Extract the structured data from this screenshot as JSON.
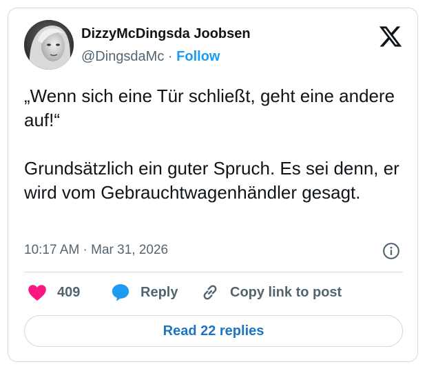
{
  "author": {
    "display_name": "DizzyMcDingsda Joobsen",
    "handle": "@DingsdaMc",
    "separator": "·",
    "follow_label": "Follow"
  },
  "tweet": {
    "text": "„Wenn sich eine Tür schließt, geht eine andere auf!“\n\nGrundsätzlich ein guter Spruch. Es sei denn, er wird vom Gebrauchtwagenhändler gesagt.",
    "timestamp": "10:17 AM · Mar 31, 2026"
  },
  "actions": {
    "like_count": "409",
    "reply_label": "Reply",
    "copy_label": "Copy link to post"
  },
  "read_replies_label": "Read 22 replies",
  "icons": {
    "brand": "x-logo-icon",
    "info": "info-icon",
    "like": "heart-icon",
    "reply": "speech-bubble-icon",
    "copy": "link-icon"
  },
  "colors": {
    "link_blue": "#1d9bf0",
    "like_pink": "#f91880",
    "secondary_text": "#536471",
    "border": "#cfd9de"
  }
}
